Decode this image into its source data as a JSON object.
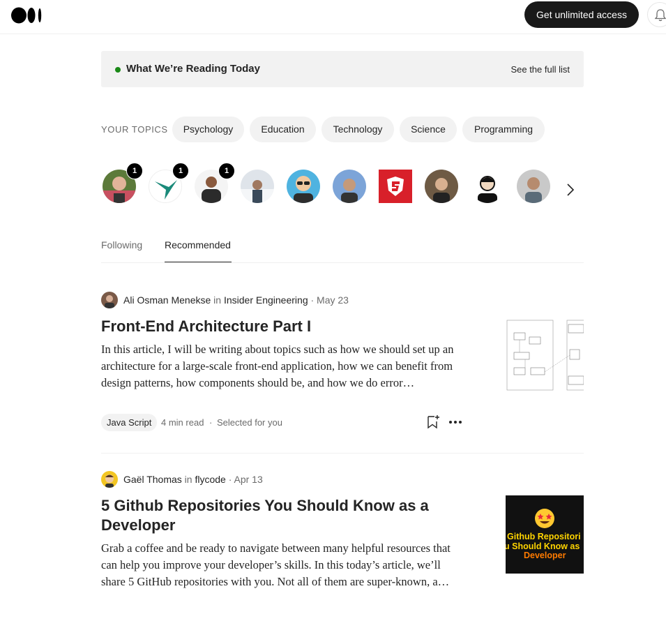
{
  "header": {
    "cta_label": "Get unlimited access",
    "logo_icon": "medium-logo-icon",
    "bell_icon": "bell-icon"
  },
  "banner": {
    "title": "What We’re Reading Today",
    "link": "See the full list",
    "dot_color": "#1a8917"
  },
  "topics": {
    "label": "YOUR TOPICS",
    "items": [
      "Psychology",
      "Education",
      "Technology",
      "Science",
      "Programming"
    ]
  },
  "following_avatars": [
    {
      "badge": "1"
    },
    {
      "badge": "1"
    },
    {
      "badge": "1"
    },
    {},
    {},
    {},
    {},
    {},
    {},
    {}
  ],
  "tabs": [
    "Following",
    "Recommended"
  ],
  "active_tab": "Recommended",
  "articles": [
    {
      "author": "Ali Osman Menekse",
      "in": "in",
      "publication": "Insider Engineering",
      "date": "· May 23",
      "title": "Front-End Architecture Part I",
      "subtitle": "In this article, I will be writing about topics such as how we should set up an architecture for a large-scale front-end application, how we can benefit from design patterns, how components should be, and how we do error…",
      "tag": "Java Script",
      "read_time": "4 min read",
      "sep": "·",
      "reason": "Selected for you"
    },
    {
      "author": "Gaël Thomas",
      "in": "in",
      "publication": "flycode",
      "date": "· Apr 13",
      "title_line1": "5 Github Repositories You Should Know as a",
      "title_line2": "Developer",
      "subtitle": "Grab a coffee and be ready to navigate between many helpful resources that can help you improve your developer’s skills. In this today’s article, we’ll share 5 GitHub repositories with you. Not all of them are super-known, a…",
      "thumb_line1": "Github Repositori",
      "thumb_line2": "u Should Know as",
      "thumb_line3": "Developer"
    }
  ],
  "colors": {
    "accent_green": "#1a8917",
    "cta_bg": "#191919",
    "chip_bg": "#f2f2f2",
    "thumb_yellow": "#ffd400",
    "thumb_orange": "#ff7a00"
  }
}
